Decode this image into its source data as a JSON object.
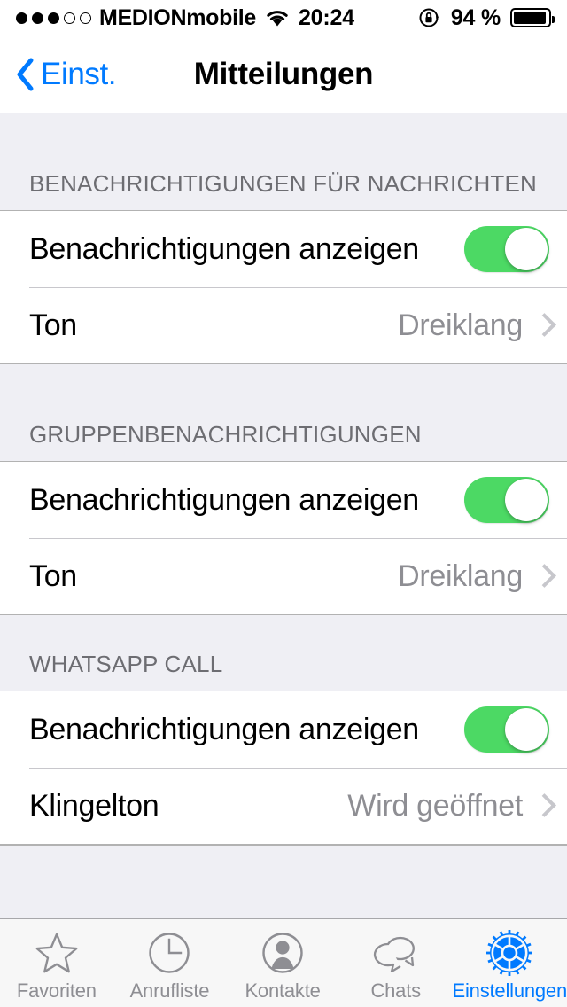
{
  "status_bar": {
    "signal_filled": 3,
    "signal_empty": 2,
    "carrier": "MEDIONmobile",
    "wifi_icon": "wifi-icon",
    "time": "20:24",
    "rotation_lock_icon": "rotation-lock-icon",
    "battery_percent": "94 %",
    "battery_icon": "battery-icon"
  },
  "nav": {
    "back_icon": "chevron-left-icon",
    "back_label": "Einst.",
    "title": "Mitteilungen"
  },
  "sections": [
    {
      "header": "BENACHRICHTIGUNGEN FÜR NACHRICHTEN",
      "rows": [
        {
          "type": "switch",
          "label": "Benachrichtigungen anzeigen",
          "value": "on"
        },
        {
          "type": "disclosure",
          "label": "Ton",
          "value": "Dreiklang"
        }
      ]
    },
    {
      "header": "GRUPPENBENACHRICHTIGUNGEN",
      "rows": [
        {
          "type": "switch",
          "label": "Benachrichtigungen anzeigen",
          "value": "on"
        },
        {
          "type": "disclosure",
          "label": "Ton",
          "value": "Dreiklang"
        }
      ]
    },
    {
      "header": "WHATSAPP CALL",
      "rows": [
        {
          "type": "switch",
          "label": "Benachrichtigungen anzeigen",
          "value": "on"
        },
        {
          "type": "disclosure",
          "label": "Klingelton",
          "value": "Wird geöffnet"
        }
      ]
    }
  ],
  "tab_bar": {
    "items": [
      {
        "label": "Favoriten",
        "icon": "star-icon",
        "active": false
      },
      {
        "label": "Anrufliste",
        "icon": "clock-icon",
        "active": false
      },
      {
        "label": "Kontakte",
        "icon": "person-icon",
        "active": false
      },
      {
        "label": "Chats",
        "icon": "chat-bubbles-icon",
        "active": false
      },
      {
        "label": "Einstellungen",
        "icon": "gear-icon",
        "active": true
      }
    ]
  },
  "colors": {
    "accent": "#007aff",
    "switch_on": "#4cd964",
    "value_text": "#8e8e93",
    "header_text": "#6d6d72",
    "group_background": "#efeff4"
  }
}
